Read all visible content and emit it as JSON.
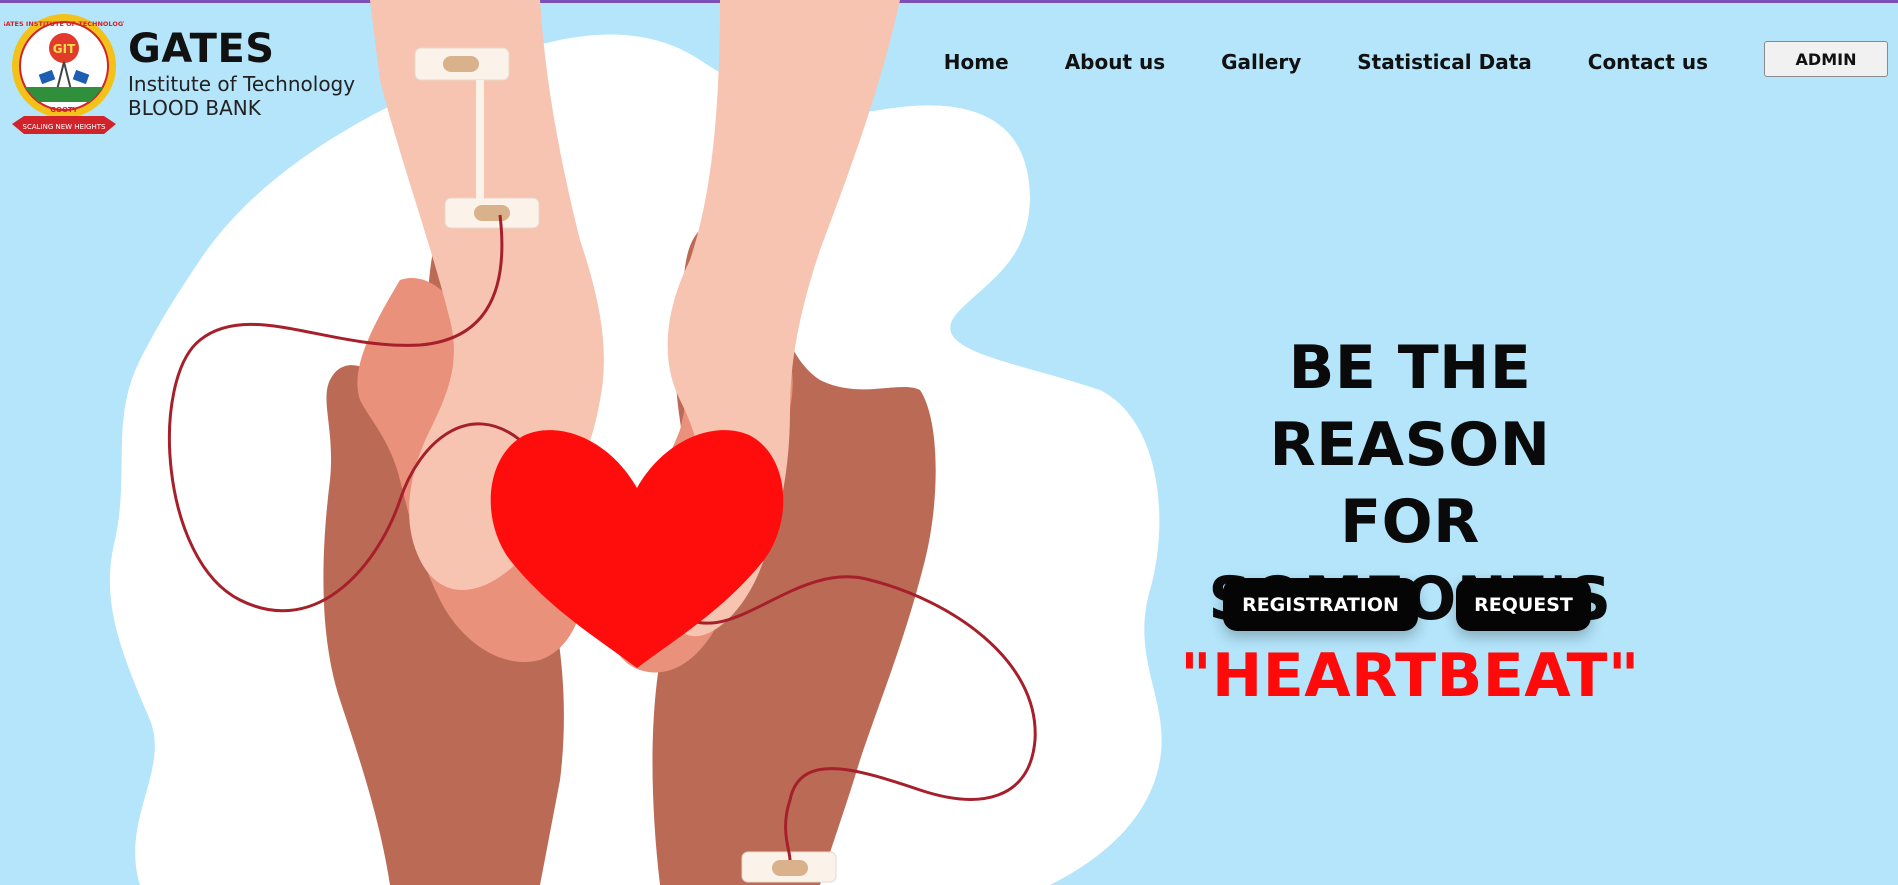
{
  "brand": {
    "title": "GATES",
    "subtitle_line1": "Institute of Technology",
    "subtitle_line2": "BLOOD BANK",
    "logo_text": [
      "GATES INSTITUTE OF TECHNOLOGY",
      "GOOTY",
      "SCALING NEW HEIGHTS",
      "GIT"
    ]
  },
  "nav": {
    "items": [
      "Home",
      "About us",
      "Gallery",
      "Statistical Data",
      "Contact us"
    ],
    "admin_label": "ADMIN"
  },
  "hero": {
    "line1": "BE THE REASON",
    "line2": "FOR SOMEONE'S",
    "line3": "\"HEARTBEAT\"",
    "registration_label": "REGISTRATION",
    "request_label": "REQUEST"
  },
  "colors": {
    "background": "#b4e5fb",
    "accent_red": "#ff0a0a",
    "button": "#050505",
    "top_border": "#7b4fb8"
  }
}
